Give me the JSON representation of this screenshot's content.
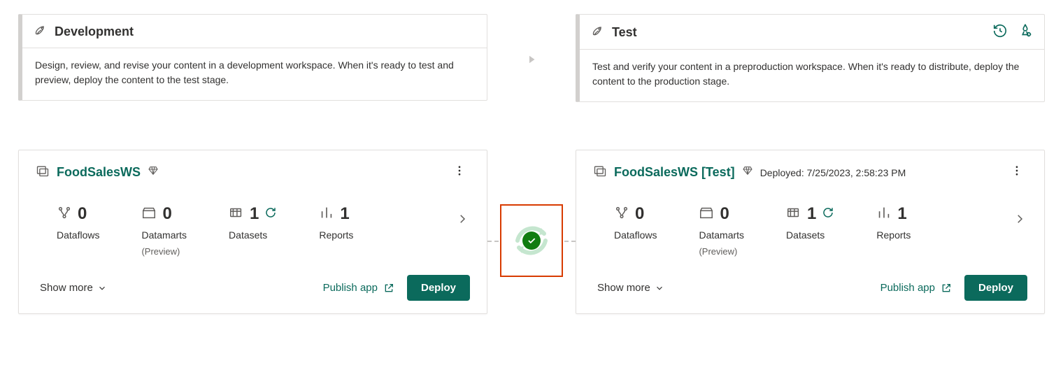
{
  "stages": {
    "dev": {
      "title": "Development",
      "description": "Design, review, and revise your content in a development workspace. When it's ready to test and preview, deploy the content to the test stage."
    },
    "test": {
      "title": "Test",
      "description": "Test and verify your content in a preproduction workspace. When it's ready to distribute, deploy the content to the production stage."
    }
  },
  "workspaces": {
    "dev": {
      "name": "FoodSalesWS",
      "metrics": {
        "dataflows": {
          "label": "Dataflows",
          "count": "0"
        },
        "datamarts": {
          "label": "Datamarts",
          "count": "0",
          "sub": "(Preview)"
        },
        "datasets": {
          "label": "Datasets",
          "count": "1"
        },
        "reports": {
          "label": "Reports",
          "count": "1"
        }
      },
      "showmore": "Show more",
      "publish": "Publish app",
      "deploy": "Deploy"
    },
    "test": {
      "name": "FoodSalesWS [Test]",
      "deployed_label": "Deployed: 7/25/2023, 2:58:23 PM",
      "metrics": {
        "dataflows": {
          "label": "Dataflows",
          "count": "0"
        },
        "datamarts": {
          "label": "Datamarts",
          "count": "0",
          "sub": "(Preview)"
        },
        "datasets": {
          "label": "Datasets",
          "count": "1"
        },
        "reports": {
          "label": "Reports",
          "count": "1"
        }
      },
      "showmore": "Show more",
      "publish": "Publish app",
      "deploy": "Deploy"
    }
  },
  "colors": {
    "accent": "#0b6a5c",
    "success": "#107c10",
    "highlight_border": "#d83b01"
  }
}
